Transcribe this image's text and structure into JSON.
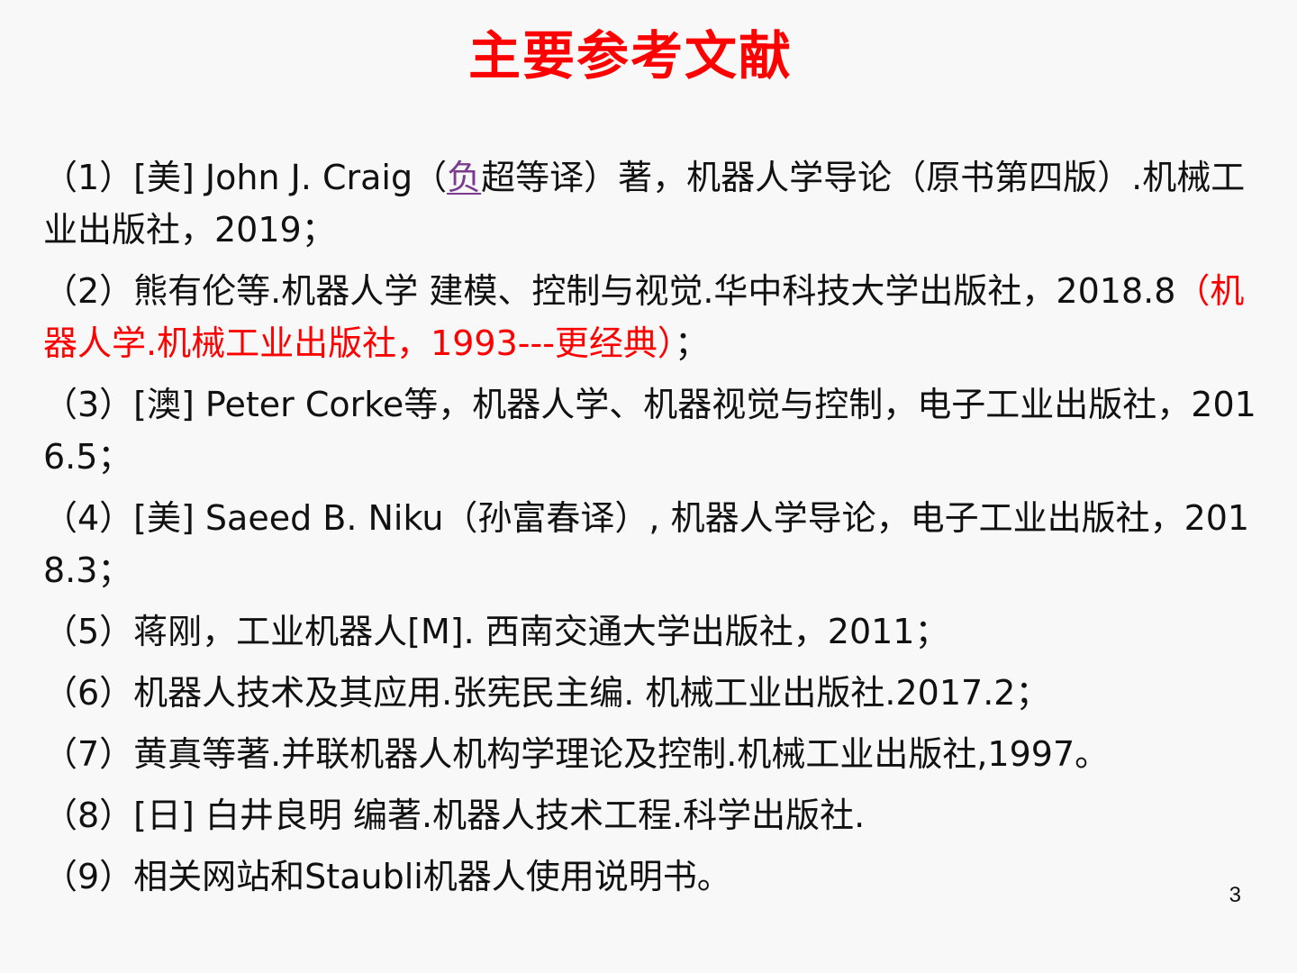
{
  "title": "主要参考文献",
  "references": [
    {
      "before": "（1）[美] John J. Craig（",
      "link": "负",
      "after": "超等译）著，机器人学导论（原书第四版）.机械工业出版社，2019；"
    },
    {
      "before": "（2）熊有伦等.机器人学 建模、控制与视觉.华中科技大学出版社，2018.8",
      "highlight": "（机器人学.机械工业出版社，1993---更经典）",
      "after": "；"
    },
    {
      "text": "（3）[澳] Peter Corke等，机器人学、机器视觉与控制，电子工业出版社，2016.5；"
    },
    {
      "text": "（4）[美] Saeed B. Niku（孙富春译）, 机器人学导论，电子工业出版社，2018.3；"
    },
    {
      "text": "（5）蒋刚，工业机器人[M]. 西南交通大学出版社，2011；"
    },
    {
      "text": "（6）机器人技术及其应用.张宪民主编. 机械工业出版社.2017.2；"
    },
    {
      "text": "（7）黄真等著.并联机器人机构学理论及控制.机械工业出版社,1997。"
    },
    {
      "text": "（8）[日] 白井良明 编著.机器人技术工程.科学出版社."
    },
    {
      "text": "（9）相关网站和Staubli机器人使用说明书。"
    }
  ],
  "page_number": "3",
  "colors": {
    "title": "#ff0000",
    "highlight": "#ff0000",
    "link": "#7a3b8f",
    "text": "#111111",
    "background": "#f8f8f8"
  }
}
